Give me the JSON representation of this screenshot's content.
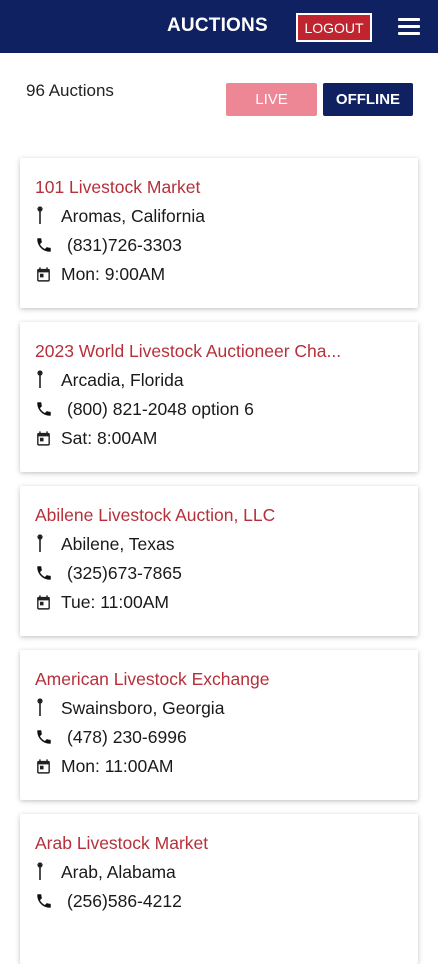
{
  "header": {
    "title": "AUCTIONS",
    "logout_label": "LOGOUT"
  },
  "filters": {
    "count_text": "96 Auctions",
    "live_label": "LIVE",
    "offline_label": "OFFLINE"
  },
  "icons": {
    "location": "pin-icon",
    "phone": "phone-icon",
    "schedule": "calendar-icon",
    "menu": "hamburger-menu-icon"
  },
  "colors": {
    "navy": "#0f2161",
    "accent_red": "#b5303a",
    "live_pink": "#ee8795"
  },
  "auctions": [
    {
      "name": "101 Livestock Market",
      "location": "Aromas, California",
      "phone": "(831)726-3303",
      "schedule": "Mon: 9:00AM"
    },
    {
      "name": "2023 World Livestock Auctioneer Cha...",
      "location": "Arcadia, Florida",
      "phone": "(800) 821-2048 option 6",
      "schedule": "Sat: 8:00AM"
    },
    {
      "name": "Abilene Livestock Auction, LLC",
      "location": "Abilene, Texas",
      "phone": "(325)673-7865",
      "schedule": "Tue: 11:00AM"
    },
    {
      "name": "American Livestock Exchange",
      "location": "Swainsboro, Georgia",
      "phone": "(478) 230-6996",
      "schedule": "Mon: 11:00AM"
    },
    {
      "name": "Arab Livestock Market",
      "location": "Arab, Alabama",
      "phone": "(256)586-4212",
      "schedule": ""
    }
  ]
}
